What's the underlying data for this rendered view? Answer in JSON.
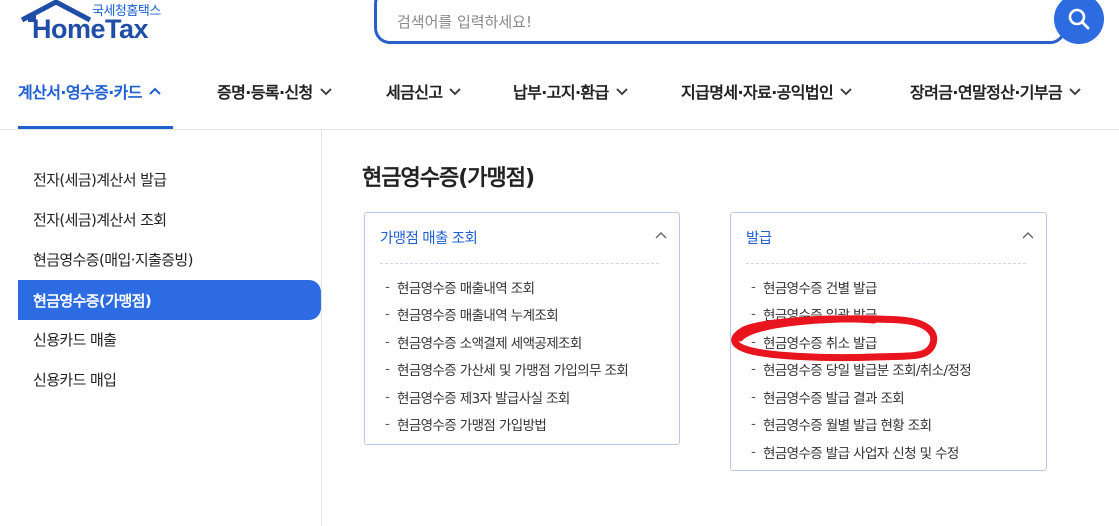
{
  "header": {
    "brand_korean": "국세청홈택스",
    "brand_english": "HomeTax",
    "search_placeholder": "검색어를 입력하세요!",
    "search_icon": "search-icon"
  },
  "nav": {
    "items": [
      {
        "label": "계산서·영수증·카드",
        "active": true,
        "icon": "chevron-up-icon"
      },
      {
        "label": "증명·등록·신청",
        "active": false,
        "icon": "chevron-down-icon"
      },
      {
        "label": "세금신고",
        "active": false,
        "icon": "chevron-down-icon"
      },
      {
        "label": "납부·고지·환급",
        "active": false,
        "icon": "chevron-down-icon"
      },
      {
        "label": "지급명세·자료·공익법인",
        "active": false,
        "icon": "chevron-down-icon"
      },
      {
        "label": "장려금·연말정산·기부금",
        "active": false,
        "icon": "chevron-down-icon"
      }
    ],
    "accent_color": "#1f5fd1"
  },
  "sidebar": {
    "items": [
      {
        "label": "전자(세금)계산서 발급",
        "active": false
      },
      {
        "label": "전자(세금)계산서 조회",
        "active": false
      },
      {
        "label": "현금영수증(매입·지출증빙)",
        "active": false
      },
      {
        "label": "현금영수증(가맹점)",
        "active": true
      },
      {
        "label": "신용카드 매출",
        "active": false
      },
      {
        "label": "신용카드 매입",
        "active": false
      }
    ],
    "active_color": "#2c6be2"
  },
  "main": {
    "title": "현금영수증(가맹점)",
    "panels": [
      {
        "heading": "가맹점 매출 조회",
        "toggle_icon": "chevron-up-icon",
        "items": [
          "현금영수증 매출내역 조회",
          "현금영수증 매출내역 누계조회",
          "현금영수증 소액결제 세액공제조회",
          "현금영수증 가산세 및 가맹점 가입의무 조회",
          "현금영수증 제3자 발급사실 조회",
          "현금영수증 가맹점 가입방법"
        ]
      },
      {
        "heading": "발급",
        "toggle_icon": "chevron-up-icon",
        "items": [
          "현금영수증 건별 발급",
          "현금영수증 일괄 발급",
          "현금영수증 취소 발급",
          "현금영수증 당일 발급분 조회/취소/정정",
          "현금영수증 발급 결과 조회",
          "현금영수증 월별 발급 현황 조회",
          "현금영수증 발급 사업자 신청 및 수정"
        ]
      }
    ]
  },
  "annotation": {
    "color": "#e8141e",
    "marks": "현금영수증 취소 발급"
  }
}
